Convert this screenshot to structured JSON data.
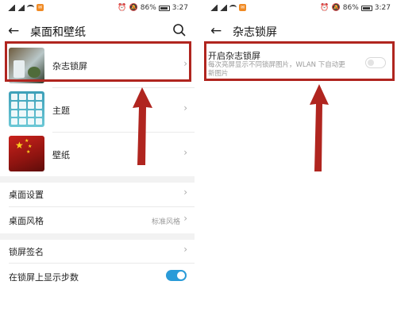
{
  "status_bar": {
    "battery": "86%",
    "time": "3:27"
  },
  "left": {
    "title": "桌面和壁纸",
    "items": [
      {
        "label": "杂志锁屏"
      },
      {
        "label": "主题"
      },
      {
        "label": "壁纸"
      }
    ],
    "settings": [
      {
        "label": "桌面设置"
      },
      {
        "label": "桌面风格",
        "value": "标准风格"
      },
      {
        "label": "锁屏签名"
      },
      {
        "label": "在锁屏上显示步数",
        "toggle": "on"
      }
    ]
  },
  "right": {
    "title": "杂志锁屏",
    "setting": {
      "label": "开启杂志锁屏",
      "description": "每次亮屏显示不同锁屏图片，WLAN 下自动更新图片",
      "toggle": "off"
    }
  },
  "colors": {
    "accent_toggle": "#2a9bd8",
    "highlight": "#b0251f"
  },
  "icons": [
    "back-arrow-icon",
    "search-icon",
    "chevron-right-icon",
    "signal-icon",
    "wifi-icon",
    "battery-icon",
    "alarm-icon",
    "mute-icon"
  ]
}
